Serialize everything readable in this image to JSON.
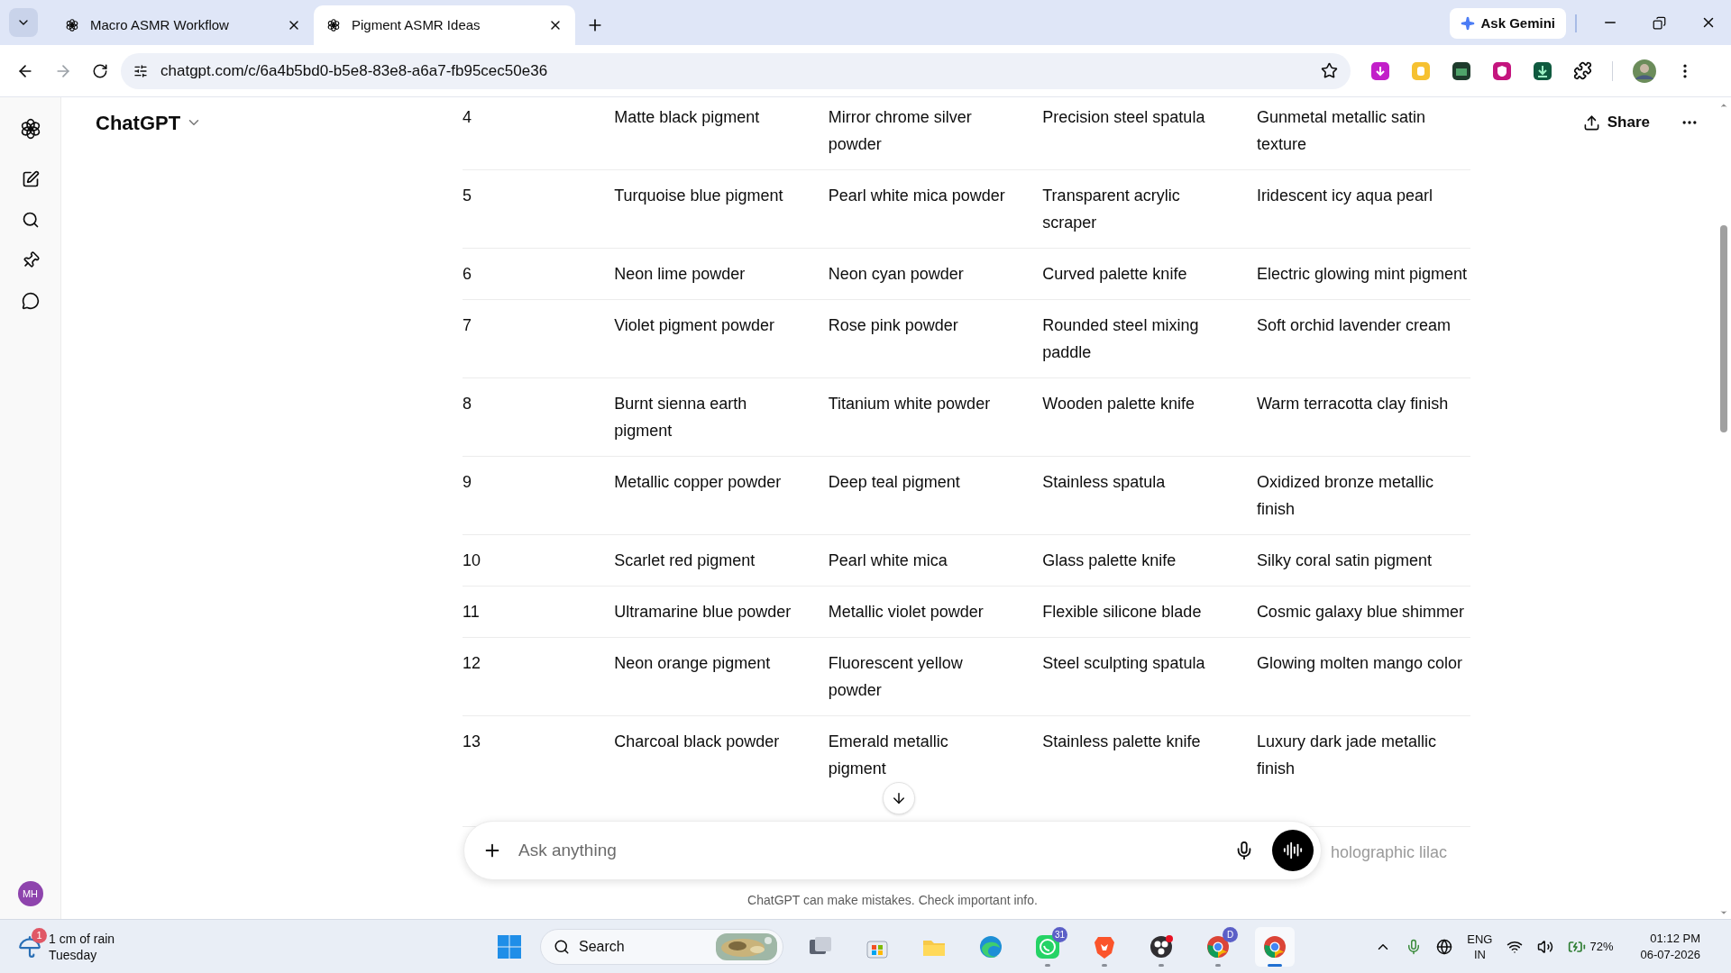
{
  "browser": {
    "tabs": [
      {
        "title": "Macro ASMR Workflow",
        "selected": false
      },
      {
        "title": "Pigment ASMR Ideas",
        "selected": true
      }
    ],
    "ask_gemini": "Ask Gemini",
    "url": "chatgpt.com/c/6a4b5bd0-b5e8-83e8-a6a7-fb95cec50e36"
  },
  "app": {
    "title": "ChatGPT",
    "share": "Share",
    "avatar": "MH",
    "table": {
      "rows": [
        {
          "cells": [
            "4",
            "Matte black pigment",
            "Mirror chrome silver powder",
            "Precision steel spatula",
            "Gunmetal metallic satin texture"
          ]
        },
        {
          "cells": [
            "5",
            "Turquoise blue pigment",
            "Pearl white mica powder",
            "Transparent acrylic scraper",
            "Iridescent icy aqua pearl"
          ]
        },
        {
          "cells": [
            "6",
            "Neon lime powder",
            "Neon cyan powder",
            "Curved palette knife",
            "Electric glowing mint pigment"
          ]
        },
        {
          "cells": [
            "7",
            "Violet pigment powder",
            "Rose pink powder",
            "Rounded steel mixing paddle",
            "Soft orchid lavender cream"
          ]
        },
        {
          "cells": [
            "8",
            "Burnt sienna earth pigment",
            "Titanium white powder",
            "Wooden palette knife",
            "Warm terracotta clay finish"
          ]
        },
        {
          "cells": [
            "9",
            "Metallic copper powder",
            "Deep teal pigment",
            "Stainless spatula",
            "Oxidized bronze metallic finish"
          ]
        },
        {
          "cells": [
            "10",
            "Scarlet red pigment",
            "Pearl white mica",
            "Glass palette knife",
            "Silky coral satin pigment"
          ]
        },
        {
          "cells": [
            "11",
            "Ultramarine blue powder",
            "Metallic violet powder",
            "Flexible silicone blade",
            "Cosmic galaxy blue shimmer"
          ]
        },
        {
          "cells": [
            "12",
            "Neon orange pigment",
            "Fluorescent yellow powder",
            "Steel sculpting spatula",
            "Glowing molten mango color"
          ]
        },
        {
          "cells": [
            "13",
            "Charcoal black powder",
            "Emerald metallic pigment",
            "Stainless palette knife",
            "Luxury dark jade metallic finish"
          ]
        }
      ],
      "partial_cell": "holographic lilac"
    },
    "composer": {
      "placeholder": "Ask anything"
    },
    "disclaimer": "ChatGPT can make mistakes. Check important info."
  },
  "taskbar": {
    "weather": {
      "text": "1 cm of rain",
      "day": "Tuesday",
      "badge": "1"
    },
    "search": "Search",
    "apps": [
      {
        "kind": "taskview",
        "running": false,
        "selected": false
      },
      {
        "kind": "store",
        "running": false,
        "selected": false
      },
      {
        "kind": "explorer",
        "running": false,
        "selected": false
      },
      {
        "kind": "edge",
        "running": false,
        "selected": false
      },
      {
        "kind": "whatsapp",
        "running": true,
        "selected": false,
        "badge": "31"
      },
      {
        "kind": "brave",
        "running": true,
        "selected": false
      },
      {
        "kind": "obs",
        "running": true,
        "selected": false
      },
      {
        "kind": "chrome",
        "running": true,
        "selected": false,
        "badge": "D"
      },
      {
        "kind": "chrome",
        "running": true,
        "selected": true
      }
    ],
    "language": "ENG",
    "region": "IN",
    "battery": "72%",
    "time": "01:12 PM",
    "date": "06-07-2026"
  }
}
